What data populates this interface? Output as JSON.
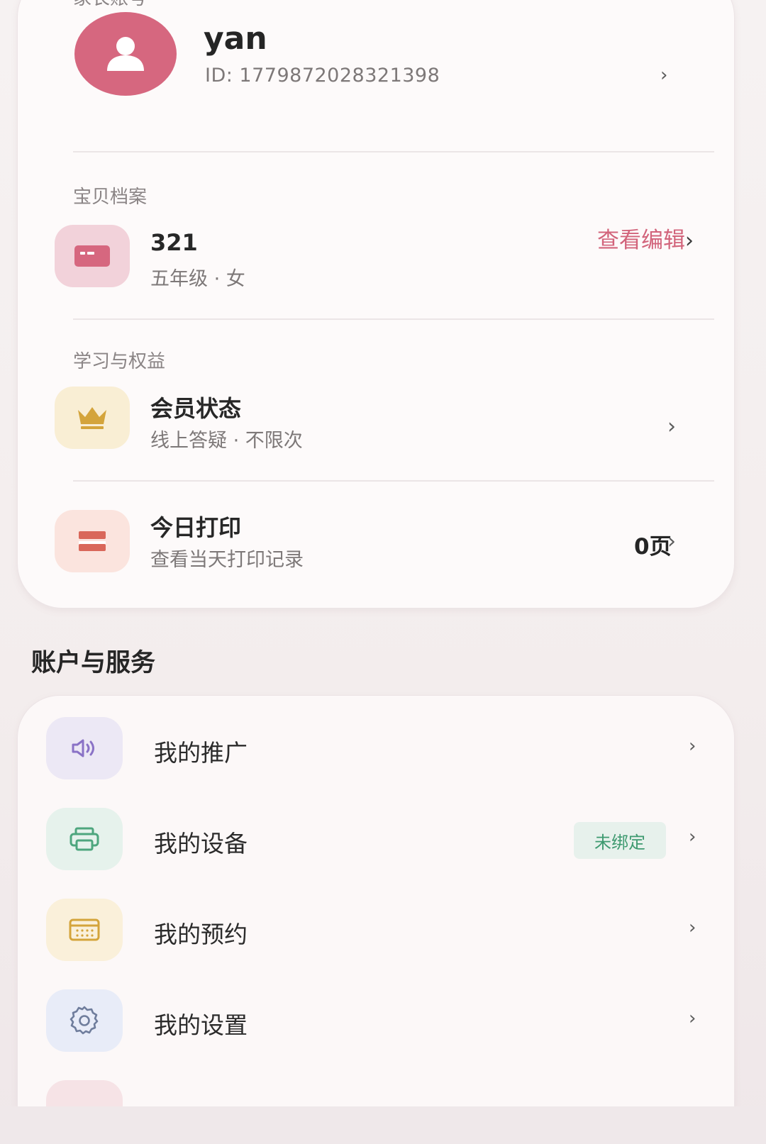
{
  "parent_account": {
    "section_label": "家长账号",
    "username": "yan",
    "user_id": "ID: 1779872028321398"
  },
  "baby_profile": {
    "section_label": "宝贝档案",
    "name": "321",
    "details": "五年级 · 女",
    "edit_label": "查看编辑"
  },
  "learning": {
    "section_label": "学习与权益",
    "membership": {
      "title": "会员状态",
      "subtitle": "线上答疑 · 不限次"
    },
    "print": {
      "title": "今日打印",
      "subtitle": "查看当天打印记录",
      "pages": "0页"
    }
  },
  "services": {
    "heading": "账户与服务",
    "items": [
      {
        "label": "我的推广",
        "icon": "speaker-icon",
        "color": "#ece8f5"
      },
      {
        "label": "我的设备",
        "icon": "printer-icon",
        "color": "#e6f2ec",
        "badge": "未绑定"
      },
      {
        "label": "我的预约",
        "icon": "calendar-icon",
        "color": "#faf0da"
      },
      {
        "label": "我的设置",
        "icon": "gear-icon",
        "color": "#e8ecf8"
      }
    ]
  },
  "colors": {
    "brand_pink": "#d6677f",
    "edit_link": "#d2647b",
    "badge_green": "#3e9a70",
    "crown_gold": "#d4a43b"
  }
}
